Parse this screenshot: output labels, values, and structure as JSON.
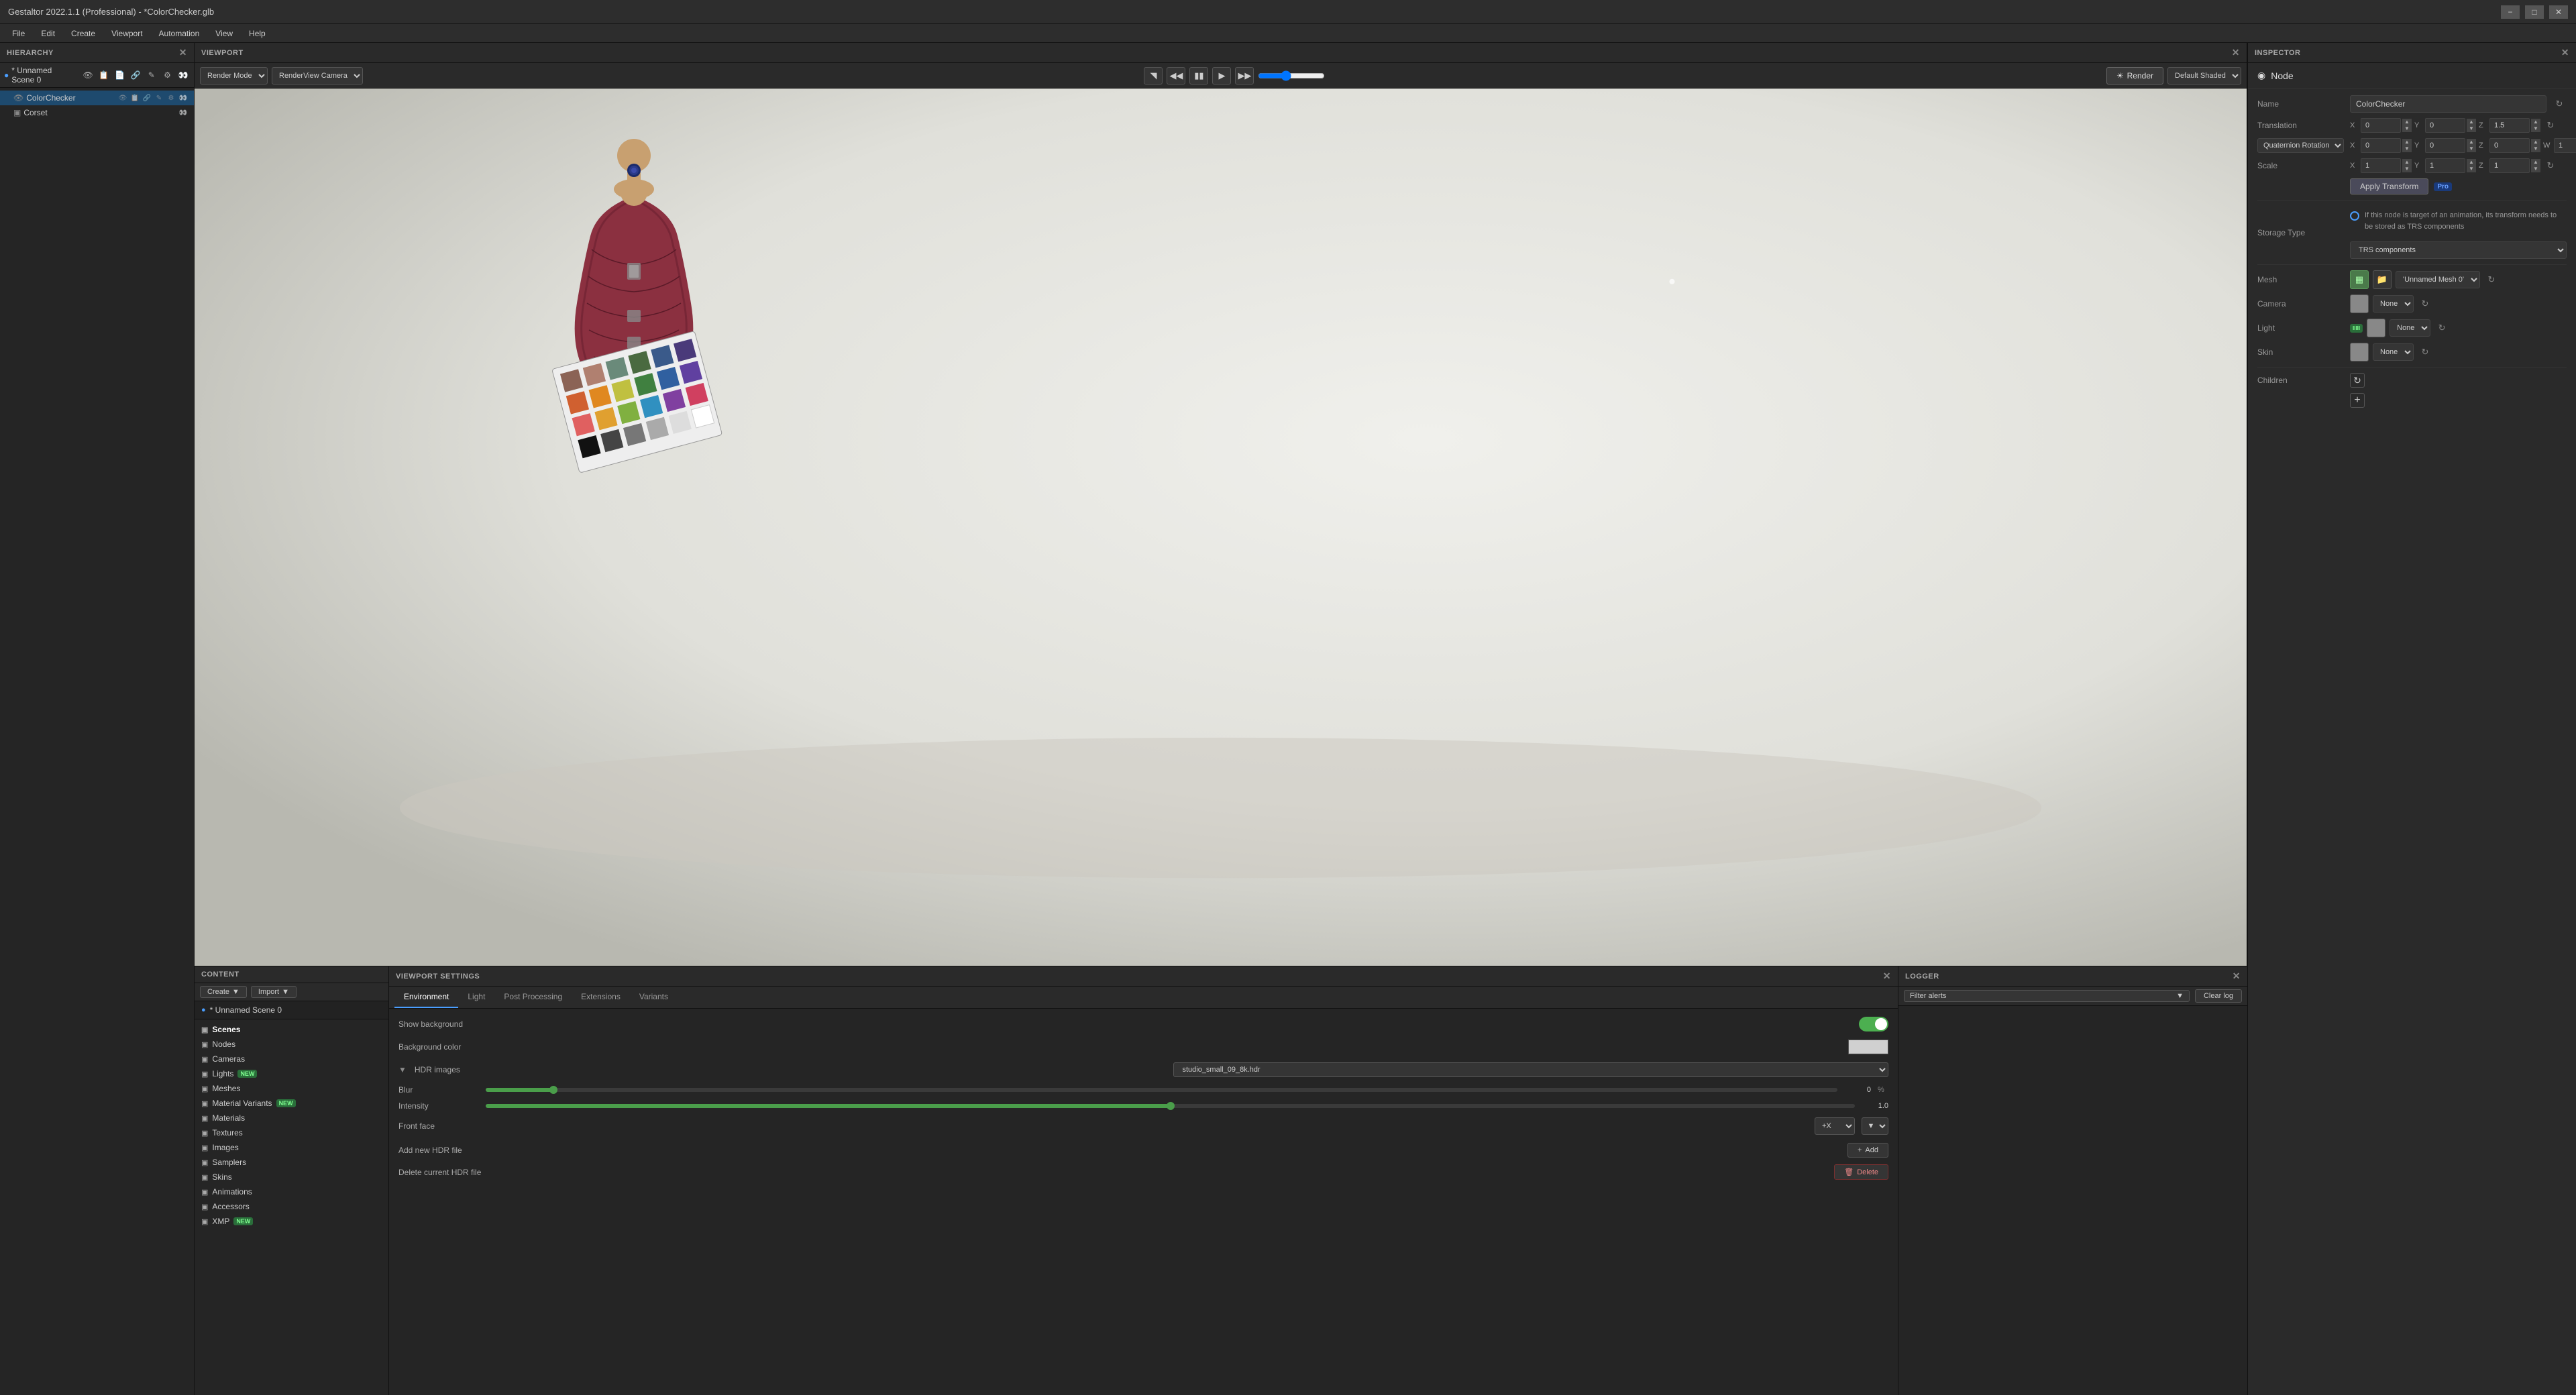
{
  "titleBar": {
    "title": "Gestaltor 2022.1.1 (Professional) - *ColorChecker.glb",
    "controls": [
      "minimize",
      "maximize",
      "close"
    ]
  },
  "menuBar": {
    "items": [
      "File",
      "Edit",
      "Create",
      "Viewport",
      "Automation",
      "View",
      "Help"
    ]
  },
  "hierarchy": {
    "panel_title": "HIERARCHY",
    "scene_label": "* Unnamed Scene 0",
    "items": [
      {
        "label": "ColorChecker",
        "selected": true,
        "indent": 1
      },
      {
        "label": "Corset",
        "indent": 1
      }
    ]
  },
  "viewport": {
    "panel_title": "VIEWPORT",
    "render_mode": "Render Mode",
    "camera": "RenderView Camera",
    "render_btn": "Render",
    "shading_mode": "Default Shaded"
  },
  "inspector": {
    "panel_title": "INSPECTOR",
    "section_title": "Node",
    "name_label": "Name",
    "name_value": "ColorChecker",
    "translation_label": "Translation",
    "translation_x": "0",
    "translation_y": "0",
    "translation_z": "1.5",
    "rotation_label": "Quaternion Rotation",
    "rotation_x": "0",
    "rotation_y": "0",
    "rotation_z": "0",
    "rotation_w": "1",
    "scale_label": "Scale",
    "scale_x": "1",
    "scale_y": "1",
    "scale_z": "1",
    "apply_transform_label": "Apply Transform",
    "pro_badge": "Pro",
    "storage_type_label": "Storage Type",
    "storage_info": "If this node is target of an animation, its transform needs to be stored as TRS components",
    "storage_value": "TRS components",
    "mesh_label": "Mesh",
    "mesh_value": "'Unnamed Mesh 0'",
    "camera_label": "Camera",
    "camera_value": "None",
    "light_label": "Light",
    "light_badge": "IIIII",
    "light_value": "None",
    "skin_label": "Skin",
    "skin_value": "None",
    "children_label": "Children"
  },
  "content": {
    "panel_title": "CONTENT",
    "create_btn": "Create",
    "import_btn": "Import",
    "tree_item_label": "* Unnamed Scene 0",
    "items": [
      {
        "label": "Scenes",
        "icon": "⬡",
        "active": true
      },
      {
        "label": "Nodes",
        "icon": "⬡"
      },
      {
        "label": "Cameras",
        "icon": "⬡"
      },
      {
        "label": "Lights",
        "icon": "⬡",
        "badge": "new",
        "badge_text": "NEW"
      },
      {
        "label": "Meshes",
        "icon": "⬡"
      },
      {
        "label": "Material Variants",
        "icon": "⬡",
        "badge": "new",
        "badge_text": "NEW"
      },
      {
        "label": "Materials",
        "icon": "⬡"
      },
      {
        "label": "Textures",
        "icon": "⬡"
      },
      {
        "label": "Images",
        "icon": "⬡"
      },
      {
        "label": "Samplers",
        "icon": "⬡"
      },
      {
        "label": "Skins",
        "icon": "⬡"
      },
      {
        "label": "Animations",
        "icon": "⬡"
      },
      {
        "label": "Accessors",
        "icon": "⬡"
      },
      {
        "label": "XMP",
        "icon": "⬡",
        "badge": "new",
        "badge_text": "NEW"
      }
    ]
  },
  "viewportSettings": {
    "panel_title": "VIEWPORT SETTINGS",
    "tabs": [
      "Environment",
      "Light",
      "Post Processing",
      "Extensions",
      "Variants"
    ],
    "active_tab": "Environment",
    "show_bg_label": "Show background",
    "bg_color_label": "Background color",
    "hdr_images_label": "HDR images",
    "hdr_value": "studio_small_09_8k.hdr",
    "blur_label": "Blur",
    "blur_value": "0",
    "blur_unit": "%",
    "intensity_label": "Intensity",
    "intensity_value": "1.0",
    "front_face_label": "Front face",
    "front_face_value": "+X",
    "add_hdr_label": "Add new HDR file",
    "add_btn": "Add",
    "delete_hdr_label": "Delete current HDR file",
    "delete_btn": "Delete"
  },
  "logger": {
    "panel_title": "LOGGER",
    "filter_label": "Filter alerts",
    "clear_btn": "Clear log"
  }
}
